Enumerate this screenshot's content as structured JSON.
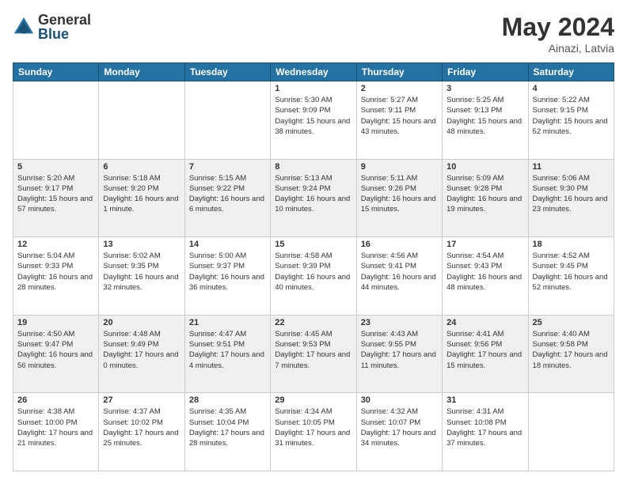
{
  "header": {
    "logo_general": "General",
    "logo_blue": "Blue",
    "month_year": "May 2024",
    "location": "Ainazi, Latvia"
  },
  "weekdays": [
    "Sunday",
    "Monday",
    "Tuesday",
    "Wednesday",
    "Thursday",
    "Friday",
    "Saturday"
  ],
  "rows": [
    [
      {
        "day": "",
        "sunrise": "",
        "sunset": "",
        "daylight": ""
      },
      {
        "day": "",
        "sunrise": "",
        "sunset": "",
        "daylight": ""
      },
      {
        "day": "",
        "sunrise": "",
        "sunset": "",
        "daylight": ""
      },
      {
        "day": "1",
        "sunrise": "Sunrise: 5:30 AM",
        "sunset": "Sunset: 9:09 PM",
        "daylight": "Daylight: 15 hours and 38 minutes."
      },
      {
        "day": "2",
        "sunrise": "Sunrise: 5:27 AM",
        "sunset": "Sunset: 9:11 PM",
        "daylight": "Daylight: 15 hours and 43 minutes."
      },
      {
        "day": "3",
        "sunrise": "Sunrise: 5:25 AM",
        "sunset": "Sunset: 9:13 PM",
        "daylight": "Daylight: 15 hours and 48 minutes."
      },
      {
        "day": "4",
        "sunrise": "Sunrise: 5:22 AM",
        "sunset": "Sunset: 9:15 PM",
        "daylight": "Daylight: 15 hours and 52 minutes."
      }
    ],
    [
      {
        "day": "5",
        "sunrise": "Sunrise: 5:20 AM",
        "sunset": "Sunset: 9:17 PM",
        "daylight": "Daylight: 15 hours and 57 minutes."
      },
      {
        "day": "6",
        "sunrise": "Sunrise: 5:18 AM",
        "sunset": "Sunset: 9:20 PM",
        "daylight": "Daylight: 16 hours and 1 minute."
      },
      {
        "day": "7",
        "sunrise": "Sunrise: 5:15 AM",
        "sunset": "Sunset: 9:22 PM",
        "daylight": "Daylight: 16 hours and 6 minutes."
      },
      {
        "day": "8",
        "sunrise": "Sunrise: 5:13 AM",
        "sunset": "Sunset: 9:24 PM",
        "daylight": "Daylight: 16 hours and 10 minutes."
      },
      {
        "day": "9",
        "sunrise": "Sunrise: 5:11 AM",
        "sunset": "Sunset: 9:26 PM",
        "daylight": "Daylight: 16 hours and 15 minutes."
      },
      {
        "day": "10",
        "sunrise": "Sunrise: 5:09 AM",
        "sunset": "Sunset: 9:28 PM",
        "daylight": "Daylight: 16 hours and 19 minutes."
      },
      {
        "day": "11",
        "sunrise": "Sunrise: 5:06 AM",
        "sunset": "Sunset: 9:30 PM",
        "daylight": "Daylight: 16 hours and 23 minutes."
      }
    ],
    [
      {
        "day": "12",
        "sunrise": "Sunrise: 5:04 AM",
        "sunset": "Sunset: 9:33 PM",
        "daylight": "Daylight: 16 hours and 28 minutes."
      },
      {
        "day": "13",
        "sunrise": "Sunrise: 5:02 AM",
        "sunset": "Sunset: 9:35 PM",
        "daylight": "Daylight: 16 hours and 32 minutes."
      },
      {
        "day": "14",
        "sunrise": "Sunrise: 5:00 AM",
        "sunset": "Sunset: 9:37 PM",
        "daylight": "Daylight: 16 hours and 36 minutes."
      },
      {
        "day": "15",
        "sunrise": "Sunrise: 4:58 AM",
        "sunset": "Sunset: 9:39 PM",
        "daylight": "Daylight: 16 hours and 40 minutes."
      },
      {
        "day": "16",
        "sunrise": "Sunrise: 4:56 AM",
        "sunset": "Sunset: 9:41 PM",
        "daylight": "Daylight: 16 hours and 44 minutes."
      },
      {
        "day": "17",
        "sunrise": "Sunrise: 4:54 AM",
        "sunset": "Sunset: 9:43 PM",
        "daylight": "Daylight: 16 hours and 48 minutes."
      },
      {
        "day": "18",
        "sunrise": "Sunrise: 4:52 AM",
        "sunset": "Sunset: 9:45 PM",
        "daylight": "Daylight: 16 hours and 52 minutes."
      }
    ],
    [
      {
        "day": "19",
        "sunrise": "Sunrise: 4:50 AM",
        "sunset": "Sunset: 9:47 PM",
        "daylight": "Daylight: 16 hours and 56 minutes."
      },
      {
        "day": "20",
        "sunrise": "Sunrise: 4:48 AM",
        "sunset": "Sunset: 9:49 PM",
        "daylight": "Daylight: 17 hours and 0 minutes."
      },
      {
        "day": "21",
        "sunrise": "Sunrise: 4:47 AM",
        "sunset": "Sunset: 9:51 PM",
        "daylight": "Daylight: 17 hours and 4 minutes."
      },
      {
        "day": "22",
        "sunrise": "Sunrise: 4:45 AM",
        "sunset": "Sunset: 9:53 PM",
        "daylight": "Daylight: 17 hours and 7 minutes."
      },
      {
        "day": "23",
        "sunrise": "Sunrise: 4:43 AM",
        "sunset": "Sunset: 9:55 PM",
        "daylight": "Daylight: 17 hours and 11 minutes."
      },
      {
        "day": "24",
        "sunrise": "Sunrise: 4:41 AM",
        "sunset": "Sunset: 9:56 PM",
        "daylight": "Daylight: 17 hours and 15 minutes."
      },
      {
        "day": "25",
        "sunrise": "Sunrise: 4:40 AM",
        "sunset": "Sunset: 9:58 PM",
        "daylight": "Daylight: 17 hours and 18 minutes."
      }
    ],
    [
      {
        "day": "26",
        "sunrise": "Sunrise: 4:38 AM",
        "sunset": "Sunset: 10:00 PM",
        "daylight": "Daylight: 17 hours and 21 minutes."
      },
      {
        "day": "27",
        "sunrise": "Sunrise: 4:37 AM",
        "sunset": "Sunset: 10:02 PM",
        "daylight": "Daylight: 17 hours and 25 minutes."
      },
      {
        "day": "28",
        "sunrise": "Sunrise: 4:35 AM",
        "sunset": "Sunset: 10:04 PM",
        "daylight": "Daylight: 17 hours and 28 minutes."
      },
      {
        "day": "29",
        "sunrise": "Sunrise: 4:34 AM",
        "sunset": "Sunset: 10:05 PM",
        "daylight": "Daylight: 17 hours and 31 minutes."
      },
      {
        "day": "30",
        "sunrise": "Sunrise: 4:32 AM",
        "sunset": "Sunset: 10:07 PM",
        "daylight": "Daylight: 17 hours and 34 minutes."
      },
      {
        "day": "31",
        "sunrise": "Sunrise: 4:31 AM",
        "sunset": "Sunset: 10:08 PM",
        "daylight": "Daylight: 17 hours and 37 minutes."
      },
      {
        "day": "",
        "sunrise": "",
        "sunset": "",
        "daylight": ""
      }
    ]
  ]
}
